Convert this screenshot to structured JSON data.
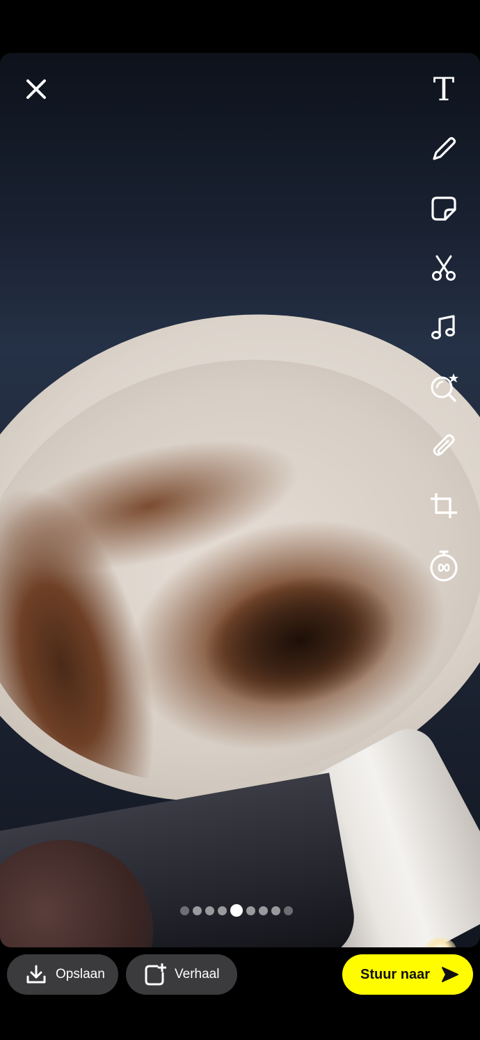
{
  "photo": {
    "description_icon": "photo-preview",
    "carousel": {
      "total_dots": 9,
      "active_index": 4
    }
  },
  "close": {
    "icon": "close-icon"
  },
  "toolbar": {
    "text_glyph": "T",
    "items": [
      {
        "icon": "text-icon"
      },
      {
        "icon": "pencil-icon"
      },
      {
        "icon": "sticker-icon"
      },
      {
        "icon": "scissors-icon"
      },
      {
        "icon": "music-icon"
      },
      {
        "icon": "lens-search-icon"
      },
      {
        "icon": "paperclip-icon"
      },
      {
        "icon": "crop-icon"
      },
      {
        "icon": "timer-icon"
      }
    ]
  },
  "bottom_bar": {
    "save_label": "Opslaan",
    "story_label": "Verhaal",
    "send_label": "Stuur naar"
  },
  "colors": {
    "accent_yellow": "#fffc00",
    "pill_bg": "#3b3b3e",
    "background": "#000000"
  }
}
